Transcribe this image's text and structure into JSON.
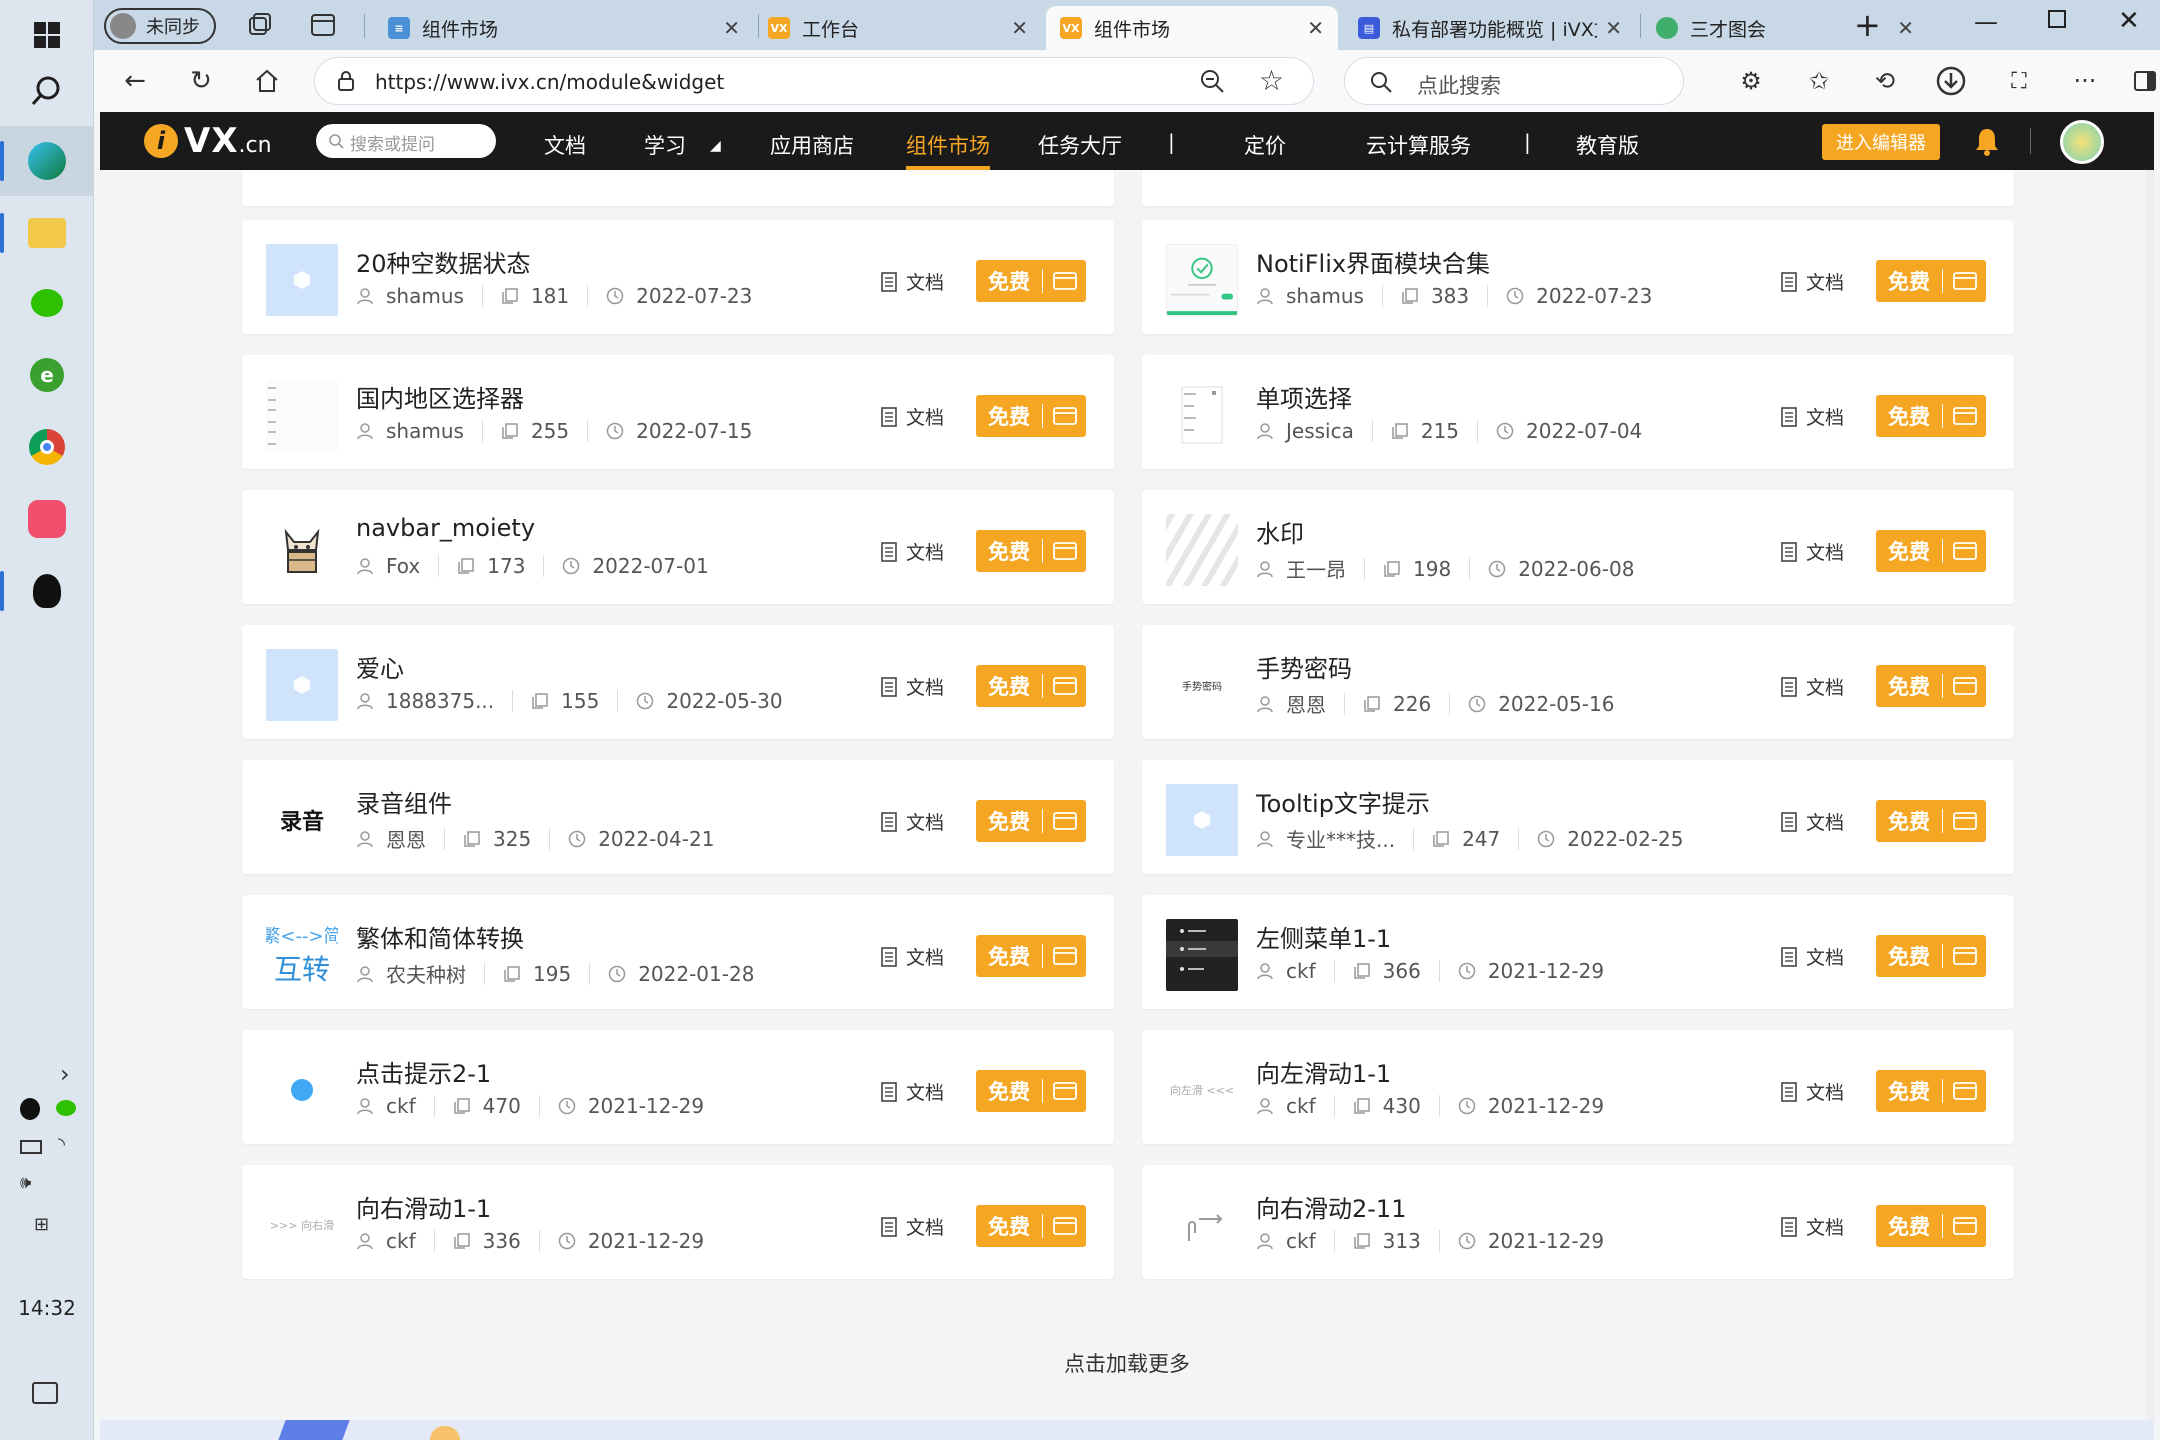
{
  "taskbar": {
    "clock": "14:32"
  },
  "browser": {
    "profile": "未同步",
    "tabs": [
      {
        "label": "组件市场",
        "active": false
      },
      {
        "label": "工作台",
        "active": false
      },
      {
        "label": "组件市场",
        "active": true
      },
      {
        "label": "私有部署功能概览 | iVX文",
        "active": false
      },
      {
        "label": "三才图会",
        "active": false
      }
    ],
    "url": "https://www.ivx.cn/module&widget",
    "search_placeholder": "点此搜索"
  },
  "site": {
    "logo_main": "VX",
    "logo_suffix": ".cn",
    "search_placeholder": "搜索或提问",
    "nav": [
      "文档",
      "学习",
      "应用商店",
      "组件市场",
      "任务大厅",
      "定价",
      "云计算服务",
      "教育版"
    ],
    "nav_sep": "|",
    "editor_button": "进入编辑器"
  },
  "labels": {
    "doc": "文档",
    "free": "免费",
    "load_more": "点击加载更多"
  },
  "widgets": [
    {
      "name": "20种空数据状态",
      "author": "shamus",
      "count": "181",
      "date": "2022-07-23",
      "thumb": "cube"
    },
    {
      "name": "NotiFlix界面模块合集",
      "author": "shamus",
      "count": "383",
      "date": "2022-07-23",
      "thumb": "notiflix"
    },
    {
      "name": "国内地区选择器",
      "author": "shamus",
      "count": "255",
      "date": "2022-07-15",
      "thumb": "region"
    },
    {
      "name": "单项选择",
      "author": "Jessica",
      "count": "215",
      "date": "2022-07-04",
      "thumb": "single"
    },
    {
      "name": "navbar_moiety",
      "author": "Fox",
      "count": "173",
      "date": "2022-07-01",
      "thumb": "fox"
    },
    {
      "name": "水印",
      "author": "王一昂",
      "count": "198",
      "date": "2022-06-08",
      "thumb": "stripes"
    },
    {
      "name": "爱心",
      "author": "1888375...",
      "count": "155",
      "date": "2022-05-30",
      "thumb": "cube"
    },
    {
      "name": "手势密码",
      "author": "恩恩",
      "count": "226",
      "date": "2022-05-16",
      "thumb": "gesture",
      "thumb_text": "手势密码"
    },
    {
      "name": "录音组件",
      "author": "恩恩",
      "count": "325",
      "date": "2022-04-21",
      "thumb": "record",
      "thumb_text": "录音"
    },
    {
      "name": "Tooltip文字提示",
      "author": "专业***技...",
      "count": "247",
      "date": "2022-02-25",
      "thumb": "cube"
    },
    {
      "name": "繁体和简体转换",
      "author": "农夫种树",
      "count": "195",
      "date": "2022-01-28",
      "thumb": "convert",
      "thumb_text": "繁<-->简",
      "thumb_text2": "互转"
    },
    {
      "name": "左侧菜单1-1",
      "author": "ckf",
      "count": "366",
      "date": "2021-12-29",
      "thumb": "menu"
    },
    {
      "name": "点击提示2-1",
      "author": "ckf",
      "count": "470",
      "date": "2021-12-29",
      "thumb": "dot"
    },
    {
      "name": "向左滑动1-1",
      "author": "ckf",
      "count": "430",
      "date": "2021-12-29",
      "thumb": "swipeleft",
      "thumb_text": "向左滑 <<<"
    },
    {
      "name": "向右滑动1-1",
      "author": "ckf",
      "count": "336",
      "date": "2021-12-29",
      "thumb": "swiperight",
      "thumb_text": ">>> 向右滑"
    },
    {
      "name": "向右滑动2-11",
      "author": "ckf",
      "count": "313",
      "date": "2021-12-29",
      "thumb": "hand"
    }
  ],
  "colors": {
    "accent": "#f5a623",
    "nav_bg": "#1a1a1a",
    "thumb_blue": "#cfe3fb"
  }
}
